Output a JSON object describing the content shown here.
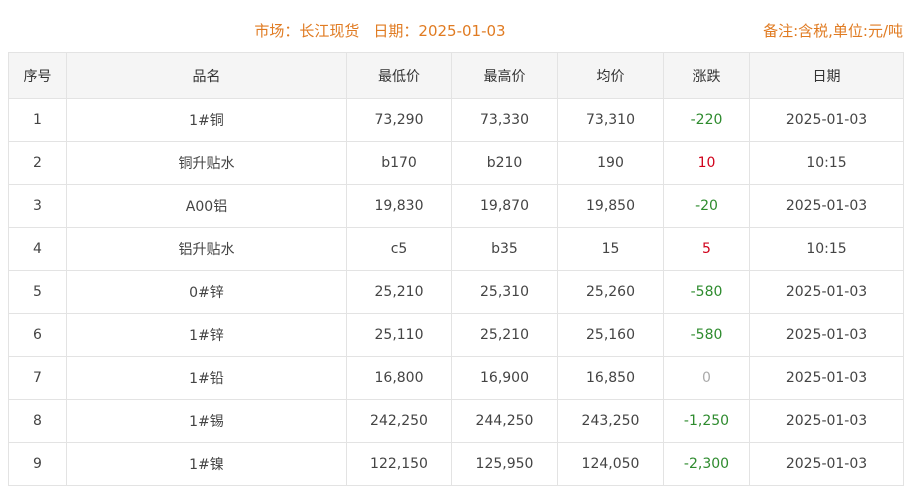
{
  "header": {
    "market": "市场：长江现货",
    "date": "日期：2025-01-03",
    "note": "备注:含税,单位:元/吨"
  },
  "colors": {
    "header_text": "#e07b22",
    "change_down": "#2e8b2e",
    "change_up": "#d0021b",
    "change_flat": "#aaaaaa"
  },
  "table": {
    "columns": [
      "序号",
      "品名",
      "最低价",
      "最高价",
      "均价",
      "涨跌",
      "日期"
    ],
    "rows": [
      {
        "idx": "1",
        "name": "1#铜",
        "low": "73,290",
        "high": "73,330",
        "avg": "73,310",
        "change": "-220",
        "trend": "down",
        "date": "2025-01-03"
      },
      {
        "idx": "2",
        "name": "铜升贴水",
        "low": "b170",
        "high": "b210",
        "avg": "190",
        "change": "10",
        "trend": "up",
        "date": "10:15"
      },
      {
        "idx": "3",
        "name": "A00铝",
        "low": "19,830",
        "high": "19,870",
        "avg": "19,850",
        "change": "-20",
        "trend": "down",
        "date": "2025-01-03"
      },
      {
        "idx": "4",
        "name": "铝升贴水",
        "low": "c5",
        "high": "b35",
        "avg": "15",
        "change": "5",
        "trend": "up",
        "date": "10:15"
      },
      {
        "idx": "5",
        "name": "0#锌",
        "low": "25,210",
        "high": "25,310",
        "avg": "25,260",
        "change": "-580",
        "trend": "down",
        "date": "2025-01-03"
      },
      {
        "idx": "6",
        "name": "1#锌",
        "low": "25,110",
        "high": "25,210",
        "avg": "25,160",
        "change": "-580",
        "trend": "down",
        "date": "2025-01-03"
      },
      {
        "idx": "7",
        "name": "1#铅",
        "low": "16,800",
        "high": "16,900",
        "avg": "16,850",
        "change": "0",
        "trend": "flat",
        "date": "2025-01-03"
      },
      {
        "idx": "8",
        "name": "1#锡",
        "low": "242,250",
        "high": "244,250",
        "avg": "243,250",
        "change": "-1,250",
        "trend": "down",
        "date": "2025-01-03"
      },
      {
        "idx": "9",
        "name": "1#镍",
        "low": "122,150",
        "high": "125,950",
        "avg": "124,050",
        "change": "-2,300",
        "trend": "down",
        "date": "2025-01-03"
      }
    ]
  }
}
